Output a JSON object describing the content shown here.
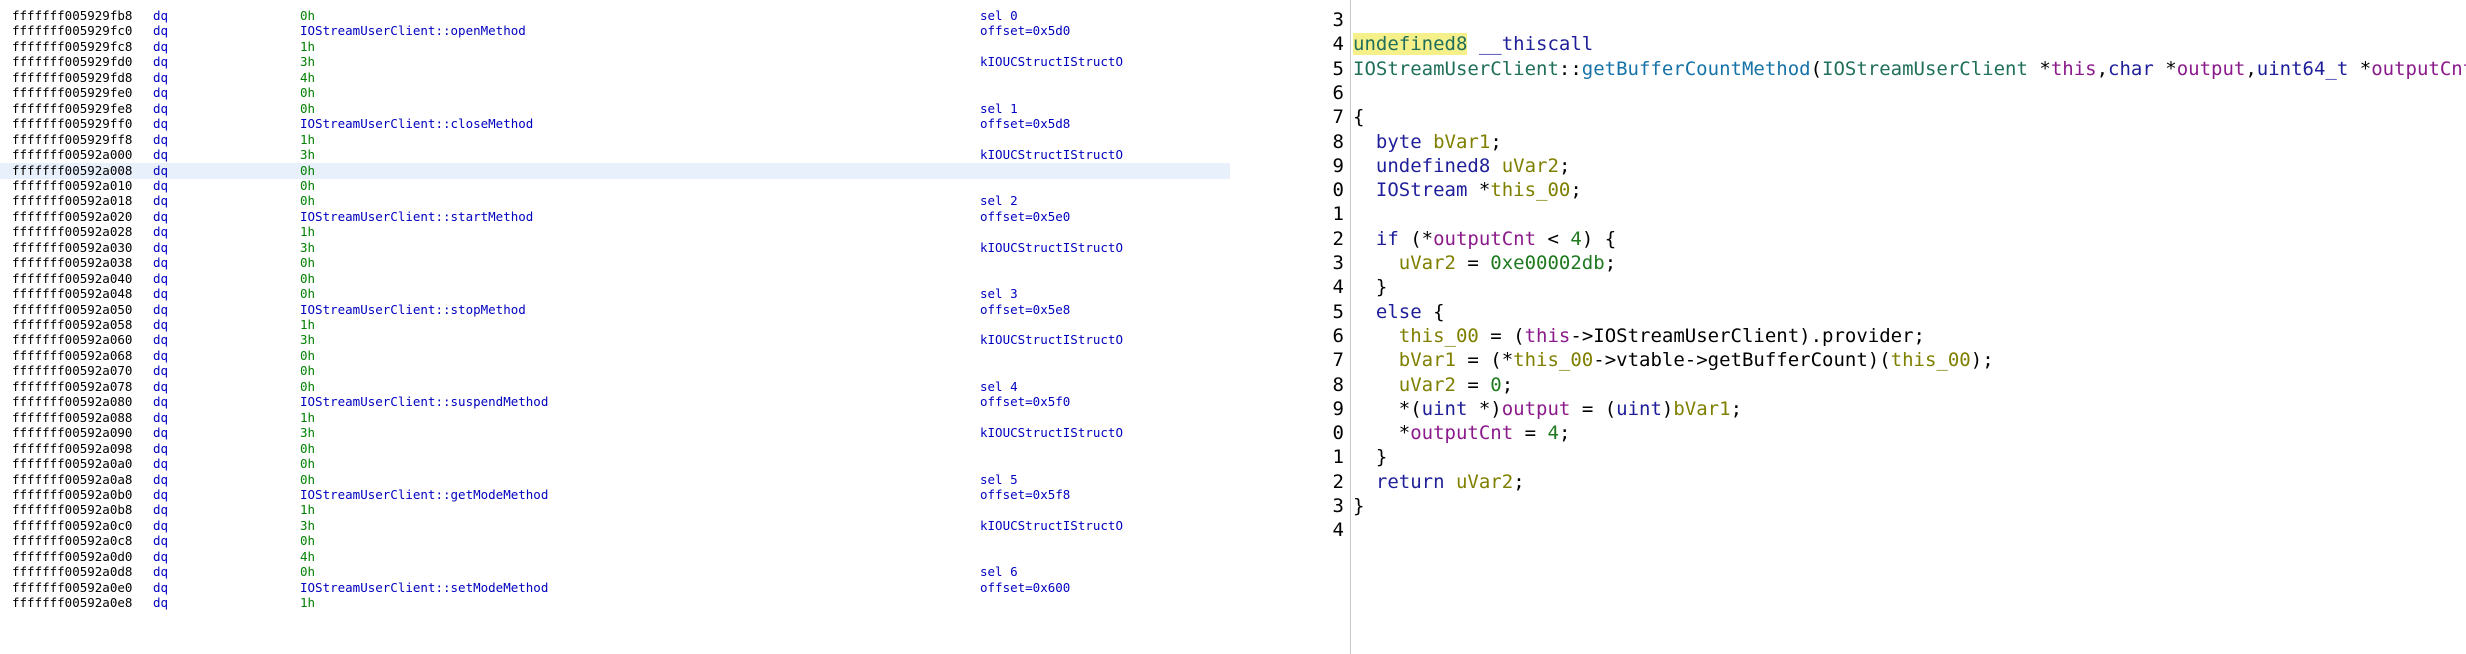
{
  "listing": {
    "rows": [
      {
        "addr": "fffffff005929fb8",
        "mnemonic": "dq",
        "operand": "0h",
        "operand_kind": "num",
        "comment": "sel 0"
      },
      {
        "addr": "fffffff005929fc0",
        "mnemonic": "dq",
        "operand": "IOStreamUserClient::openMethod",
        "operand_kind": "ref",
        "comment": "offset=0x5d0"
      },
      {
        "addr": "fffffff005929fc8",
        "mnemonic": "dq",
        "operand": "1h",
        "operand_kind": "num",
        "comment": ""
      },
      {
        "addr": "fffffff005929fd0",
        "mnemonic": "dq",
        "operand": "3h",
        "operand_kind": "num",
        "comment": "kIOUCStructIStructO"
      },
      {
        "addr": "fffffff005929fd8",
        "mnemonic": "dq",
        "operand": "4h",
        "operand_kind": "num",
        "comment": ""
      },
      {
        "addr": "fffffff005929fe0",
        "mnemonic": "dq",
        "operand": "0h",
        "operand_kind": "num",
        "comment": ""
      },
      {
        "addr": "fffffff005929fe8",
        "mnemonic": "dq",
        "operand": "0h",
        "operand_kind": "num",
        "comment": "sel 1"
      },
      {
        "addr": "fffffff005929ff0",
        "mnemonic": "dq",
        "operand": "IOStreamUserClient::closeMethod",
        "operand_kind": "ref",
        "comment": "offset=0x5d8"
      },
      {
        "addr": "fffffff005929ff8",
        "mnemonic": "dq",
        "operand": "1h",
        "operand_kind": "num",
        "comment": ""
      },
      {
        "addr": "fffffff00592a000",
        "mnemonic": "dq",
        "operand": "3h",
        "operand_kind": "num",
        "comment": "kIOUCStructIStructO"
      },
      {
        "addr": "fffffff00592a008",
        "mnemonic": "dq",
        "operand": "0h",
        "operand_kind": "num",
        "comment": "",
        "highlight": true
      },
      {
        "addr": "fffffff00592a010",
        "mnemonic": "dq",
        "operand": "0h",
        "operand_kind": "num",
        "comment": ""
      },
      {
        "addr": "fffffff00592a018",
        "mnemonic": "dq",
        "operand": "0h",
        "operand_kind": "num",
        "comment": "sel 2"
      },
      {
        "addr": "fffffff00592a020",
        "mnemonic": "dq",
        "operand": "IOStreamUserClient::startMethod",
        "operand_kind": "ref",
        "comment": "offset=0x5e0"
      },
      {
        "addr": "fffffff00592a028",
        "mnemonic": "dq",
        "operand": "1h",
        "operand_kind": "num",
        "comment": ""
      },
      {
        "addr": "fffffff00592a030",
        "mnemonic": "dq",
        "operand": "3h",
        "operand_kind": "num",
        "comment": "kIOUCStructIStructO"
      },
      {
        "addr": "fffffff00592a038",
        "mnemonic": "dq",
        "operand": "0h",
        "operand_kind": "num",
        "comment": ""
      },
      {
        "addr": "fffffff00592a040",
        "mnemonic": "dq",
        "operand": "0h",
        "operand_kind": "num",
        "comment": ""
      },
      {
        "addr": "fffffff00592a048",
        "mnemonic": "dq",
        "operand": "0h",
        "operand_kind": "num",
        "comment": "sel 3"
      },
      {
        "addr": "fffffff00592a050",
        "mnemonic": "dq",
        "operand": "IOStreamUserClient::stopMethod",
        "operand_kind": "ref",
        "comment": "offset=0x5e8"
      },
      {
        "addr": "fffffff00592a058",
        "mnemonic": "dq",
        "operand": "1h",
        "operand_kind": "num",
        "comment": ""
      },
      {
        "addr": "fffffff00592a060",
        "mnemonic": "dq",
        "operand": "3h",
        "operand_kind": "num",
        "comment": "kIOUCStructIStructO"
      },
      {
        "addr": "fffffff00592a068",
        "mnemonic": "dq",
        "operand": "0h",
        "operand_kind": "num",
        "comment": ""
      },
      {
        "addr": "fffffff00592a070",
        "mnemonic": "dq",
        "operand": "0h",
        "operand_kind": "num",
        "comment": ""
      },
      {
        "addr": "fffffff00592a078",
        "mnemonic": "dq",
        "operand": "0h",
        "operand_kind": "num",
        "comment": "sel 4"
      },
      {
        "addr": "fffffff00592a080",
        "mnemonic": "dq",
        "operand": "IOStreamUserClient::suspendMethod",
        "operand_kind": "ref",
        "comment": "offset=0x5f0"
      },
      {
        "addr": "fffffff00592a088",
        "mnemonic": "dq",
        "operand": "1h",
        "operand_kind": "num",
        "comment": ""
      },
      {
        "addr": "fffffff00592a090",
        "mnemonic": "dq",
        "operand": "3h",
        "operand_kind": "num",
        "comment": "kIOUCStructIStructO"
      },
      {
        "addr": "fffffff00592a098",
        "mnemonic": "dq",
        "operand": "0h",
        "operand_kind": "num",
        "comment": ""
      },
      {
        "addr": "fffffff00592a0a0",
        "mnemonic": "dq",
        "operand": "0h",
        "operand_kind": "num",
        "comment": ""
      },
      {
        "addr": "fffffff00592a0a8",
        "mnemonic": "dq",
        "operand": "0h",
        "operand_kind": "num",
        "comment": "sel 5"
      },
      {
        "addr": "fffffff00592a0b0",
        "mnemonic": "dq",
        "operand": "IOStreamUserClient::getModeMethod",
        "operand_kind": "ref",
        "comment": "offset=0x5f8"
      },
      {
        "addr": "fffffff00592a0b8",
        "mnemonic": "dq",
        "operand": "1h",
        "operand_kind": "num",
        "comment": ""
      },
      {
        "addr": "fffffff00592a0c0",
        "mnemonic": "dq",
        "operand": "3h",
        "operand_kind": "num",
        "comment": "kIOUCStructIStructO"
      },
      {
        "addr": "fffffff00592a0c8",
        "mnemonic": "dq",
        "operand": "0h",
        "operand_kind": "num",
        "comment": ""
      },
      {
        "addr": "fffffff00592a0d0",
        "mnemonic": "dq",
        "operand": "4h",
        "operand_kind": "num",
        "comment": ""
      },
      {
        "addr": "fffffff00592a0d8",
        "mnemonic": "dq",
        "operand": "0h",
        "operand_kind": "num",
        "comment": "sel 6"
      },
      {
        "addr": "fffffff00592a0e0",
        "mnemonic": "dq",
        "operand": "IOStreamUserClient::setModeMethod",
        "operand_kind": "ref",
        "comment": "offset=0x600"
      },
      {
        "addr": "fffffff00592a0e8",
        "mnemonic": "dq",
        "operand": "1h",
        "operand_kind": "num",
        "comment": ""
      }
    ]
  },
  "decompiler": {
    "lines": [
      {
        "num": "3",
        "tokens": []
      },
      {
        "num": "4",
        "tokens": [
          {
            "t": "undefined8",
            "c": "type hl"
          },
          {
            "t": " __thiscall",
            "c": "kw"
          }
        ]
      },
      {
        "num": "5",
        "tokens": [
          {
            "t": "IOStreamUserClient",
            "c": "type"
          },
          {
            "t": "::",
            "c": ""
          },
          {
            "t": "getBufferCountMethod",
            "c": "func"
          },
          {
            "t": "(",
            "c": ""
          },
          {
            "t": "IOStreamUserClient",
            "c": "type"
          },
          {
            "t": " *",
            "c": ""
          },
          {
            "t": "this",
            "c": "param"
          },
          {
            "t": ",",
            "c": ""
          },
          {
            "t": "char",
            "c": "kw"
          },
          {
            "t": " *",
            "c": ""
          },
          {
            "t": "output",
            "c": "param"
          },
          {
            "t": ",",
            "c": ""
          },
          {
            "t": "uint64_t",
            "c": "kw"
          },
          {
            "t": " *",
            "c": ""
          },
          {
            "t": "outputCnt",
            "c": "param"
          },
          {
            "t": ")",
            "c": ""
          }
        ]
      },
      {
        "num": "6",
        "tokens": []
      },
      {
        "num": "7",
        "tokens": [
          {
            "t": "{",
            "c": ""
          }
        ]
      },
      {
        "num": "8",
        "tokens": [
          {
            "t": "  ",
            "c": ""
          },
          {
            "t": "byte",
            "c": "kw"
          },
          {
            "t": " ",
            "c": ""
          },
          {
            "t": "bVar1",
            "c": "var"
          },
          {
            "t": ";",
            "c": ""
          }
        ]
      },
      {
        "num": "9",
        "tokens": [
          {
            "t": "  ",
            "c": ""
          },
          {
            "t": "undefined8",
            "c": "kw"
          },
          {
            "t": " ",
            "c": ""
          },
          {
            "t": "uVar2",
            "c": "var"
          },
          {
            "t": ";",
            "c": ""
          }
        ]
      },
      {
        "num": "0",
        "tokens": [
          {
            "t": "  ",
            "c": ""
          },
          {
            "t": "IOStream",
            "c": "kw"
          },
          {
            "t": " *",
            "c": ""
          },
          {
            "t": "this_00",
            "c": "var"
          },
          {
            "t": ";",
            "c": ""
          }
        ]
      },
      {
        "num": "1",
        "tokens": []
      },
      {
        "num": "2",
        "tokens": [
          {
            "t": "  ",
            "c": ""
          },
          {
            "t": "if",
            "c": "kw"
          },
          {
            "t": " (*",
            "c": ""
          },
          {
            "t": "outputCnt",
            "c": "param"
          },
          {
            "t": " < ",
            "c": ""
          },
          {
            "t": "4",
            "c": "num"
          },
          {
            "t": ") {",
            "c": ""
          }
        ]
      },
      {
        "num": "3",
        "tokens": [
          {
            "t": "    ",
            "c": ""
          },
          {
            "t": "uVar2",
            "c": "var"
          },
          {
            "t": " = ",
            "c": ""
          },
          {
            "t": "0xe00002db",
            "c": "num"
          },
          {
            "t": ";",
            "c": ""
          }
        ]
      },
      {
        "num": "4",
        "tokens": [
          {
            "t": "  }",
            "c": ""
          }
        ]
      },
      {
        "num": "5",
        "tokens": [
          {
            "t": "  ",
            "c": ""
          },
          {
            "t": "else",
            "c": "kw"
          },
          {
            "t": " {",
            "c": ""
          }
        ]
      },
      {
        "num": "6",
        "tokens": [
          {
            "t": "    ",
            "c": ""
          },
          {
            "t": "this_00",
            "c": "var"
          },
          {
            "t": " = (",
            "c": ""
          },
          {
            "t": "this",
            "c": "param"
          },
          {
            "t": "->IOStreamUserClient).provider;",
            "c": ""
          }
        ]
      },
      {
        "num": "7",
        "tokens": [
          {
            "t": "    ",
            "c": ""
          },
          {
            "t": "bVar1",
            "c": "var"
          },
          {
            "t": " = (*",
            "c": ""
          },
          {
            "t": "this_00",
            "c": "var"
          },
          {
            "t": "->vtable->getBufferCount)(",
            "c": ""
          },
          {
            "t": "this_00",
            "c": "var"
          },
          {
            "t": ");",
            "c": ""
          }
        ]
      },
      {
        "num": "8",
        "tokens": [
          {
            "t": "    ",
            "c": ""
          },
          {
            "t": "uVar2",
            "c": "var"
          },
          {
            "t": " = ",
            "c": ""
          },
          {
            "t": "0",
            "c": "num"
          },
          {
            "t": ";",
            "c": ""
          }
        ]
      },
      {
        "num": "9",
        "tokens": [
          {
            "t": "    *(",
            "c": ""
          },
          {
            "t": "uint",
            "c": "kw"
          },
          {
            "t": " *)",
            "c": ""
          },
          {
            "t": "output",
            "c": "param"
          },
          {
            "t": " = (",
            "c": ""
          },
          {
            "t": "uint",
            "c": "kw"
          },
          {
            "t": ")",
            "c": ""
          },
          {
            "t": "bVar1",
            "c": "var"
          },
          {
            "t": ";",
            "c": ""
          }
        ]
      },
      {
        "num": "0",
        "tokens": [
          {
            "t": "    *",
            "c": ""
          },
          {
            "t": "outputCnt",
            "c": "param"
          },
          {
            "t": " = ",
            "c": ""
          },
          {
            "t": "4",
            "c": "num"
          },
          {
            "t": ";",
            "c": ""
          }
        ]
      },
      {
        "num": "1",
        "tokens": [
          {
            "t": "  }",
            "c": ""
          }
        ]
      },
      {
        "num": "2",
        "tokens": [
          {
            "t": "  ",
            "c": ""
          },
          {
            "t": "return",
            "c": "kw"
          },
          {
            "t": " ",
            "c": ""
          },
          {
            "t": "uVar2",
            "c": "var"
          },
          {
            "t": ";",
            "c": ""
          }
        ]
      },
      {
        "num": "3",
        "tokens": [
          {
            "t": "}",
            "c": ""
          }
        ]
      },
      {
        "num": "4",
        "tokens": []
      }
    ]
  }
}
